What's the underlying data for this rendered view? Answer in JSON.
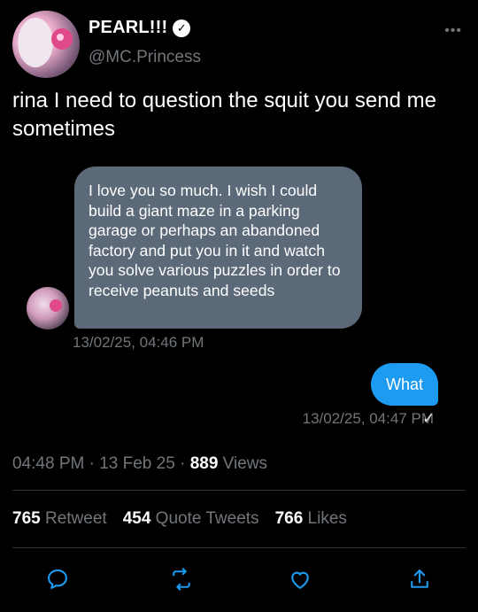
{
  "profile": {
    "name": "PEARL!!!",
    "handle": "@MC.Princess",
    "more_label": "•••"
  },
  "tweet": {
    "text": "rina I need to question the squit you send me sometimes"
  },
  "dm": {
    "received": {
      "text": "I love you so much. I wish I could build a giant maze in a parking garage or perhaps an abandoned factory and put you in it and watch you solve various puzzles in order to receive peanuts and seeds",
      "timestamp": "13/02/25, 04:46 PM"
    },
    "sent": {
      "text": "What",
      "timestamp": "13/02/25, 04:47 PM",
      "status": "✓"
    }
  },
  "meta": {
    "time": "04:48 PM",
    "sep1": " · ",
    "date": "13 Feb 25",
    "sep2": " · ",
    "views_count": "889",
    "views_label": "Views"
  },
  "stats": {
    "retweets_count": "765",
    "retweets_label": "Retweet",
    "quotes_count": "454",
    "quotes_label": "Quote Tweets",
    "likes_count": "766",
    "likes_label": "Likes"
  },
  "colors": {
    "background": "#000000",
    "accent": "#1d9bf0",
    "dm_bubble": "#5b6978",
    "muted": "#71767b"
  },
  "icons": [
    "reply-icon",
    "retweet-icon",
    "like-icon",
    "share-icon",
    "verified-icon",
    "more-icon"
  ]
}
